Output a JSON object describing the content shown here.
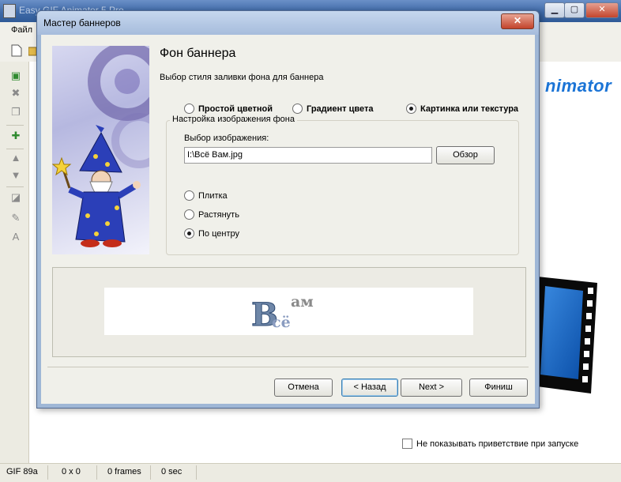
{
  "app": {
    "title": "Easy GIF Animator 5 Pro",
    "menu_file": "Файл",
    "brand": "nimator"
  },
  "dialog": {
    "title": "Мастер баннеров",
    "close_label": "✕",
    "page_title": "Фон баннера",
    "subtitle": "Выбор стиля заливки фона для баннера",
    "fill_style_options": [
      {
        "label": "Простой цветной",
        "checked": false
      },
      {
        "label": "Градиент цвета",
        "checked": false
      },
      {
        "label": "Картинка или текстура",
        "checked": true
      }
    ],
    "group_label": "Настройка изображения фона",
    "image_label": "Выбор изображения:",
    "image_path": "I:\\Всё Вам.jpg",
    "browse_button": "Обзор",
    "placement_options": [
      {
        "label": "Плитка",
        "checked": false
      },
      {
        "label": "Растянуть",
        "checked": false
      },
      {
        "label": "По центру",
        "checked": true
      }
    ],
    "preview_text": {
      "big": "В",
      "top": "ам",
      "bottom": "сё"
    },
    "buttons": {
      "cancel": "Отмена",
      "back": "< Назад",
      "next": "Next >",
      "finish": "Финиш"
    }
  },
  "startup": {
    "checkbox_label": "Не показывать приветствие при запуске",
    "checked": false
  },
  "statusbar": {
    "format": "GIF 89a",
    "size": "0 x 0",
    "frames": "0 frames",
    "duration": "0 sec"
  },
  "colors": {
    "accent": "#1b74d6",
    "dialog_frame": "#9fb7d6",
    "close_red": "#c3432b"
  }
}
